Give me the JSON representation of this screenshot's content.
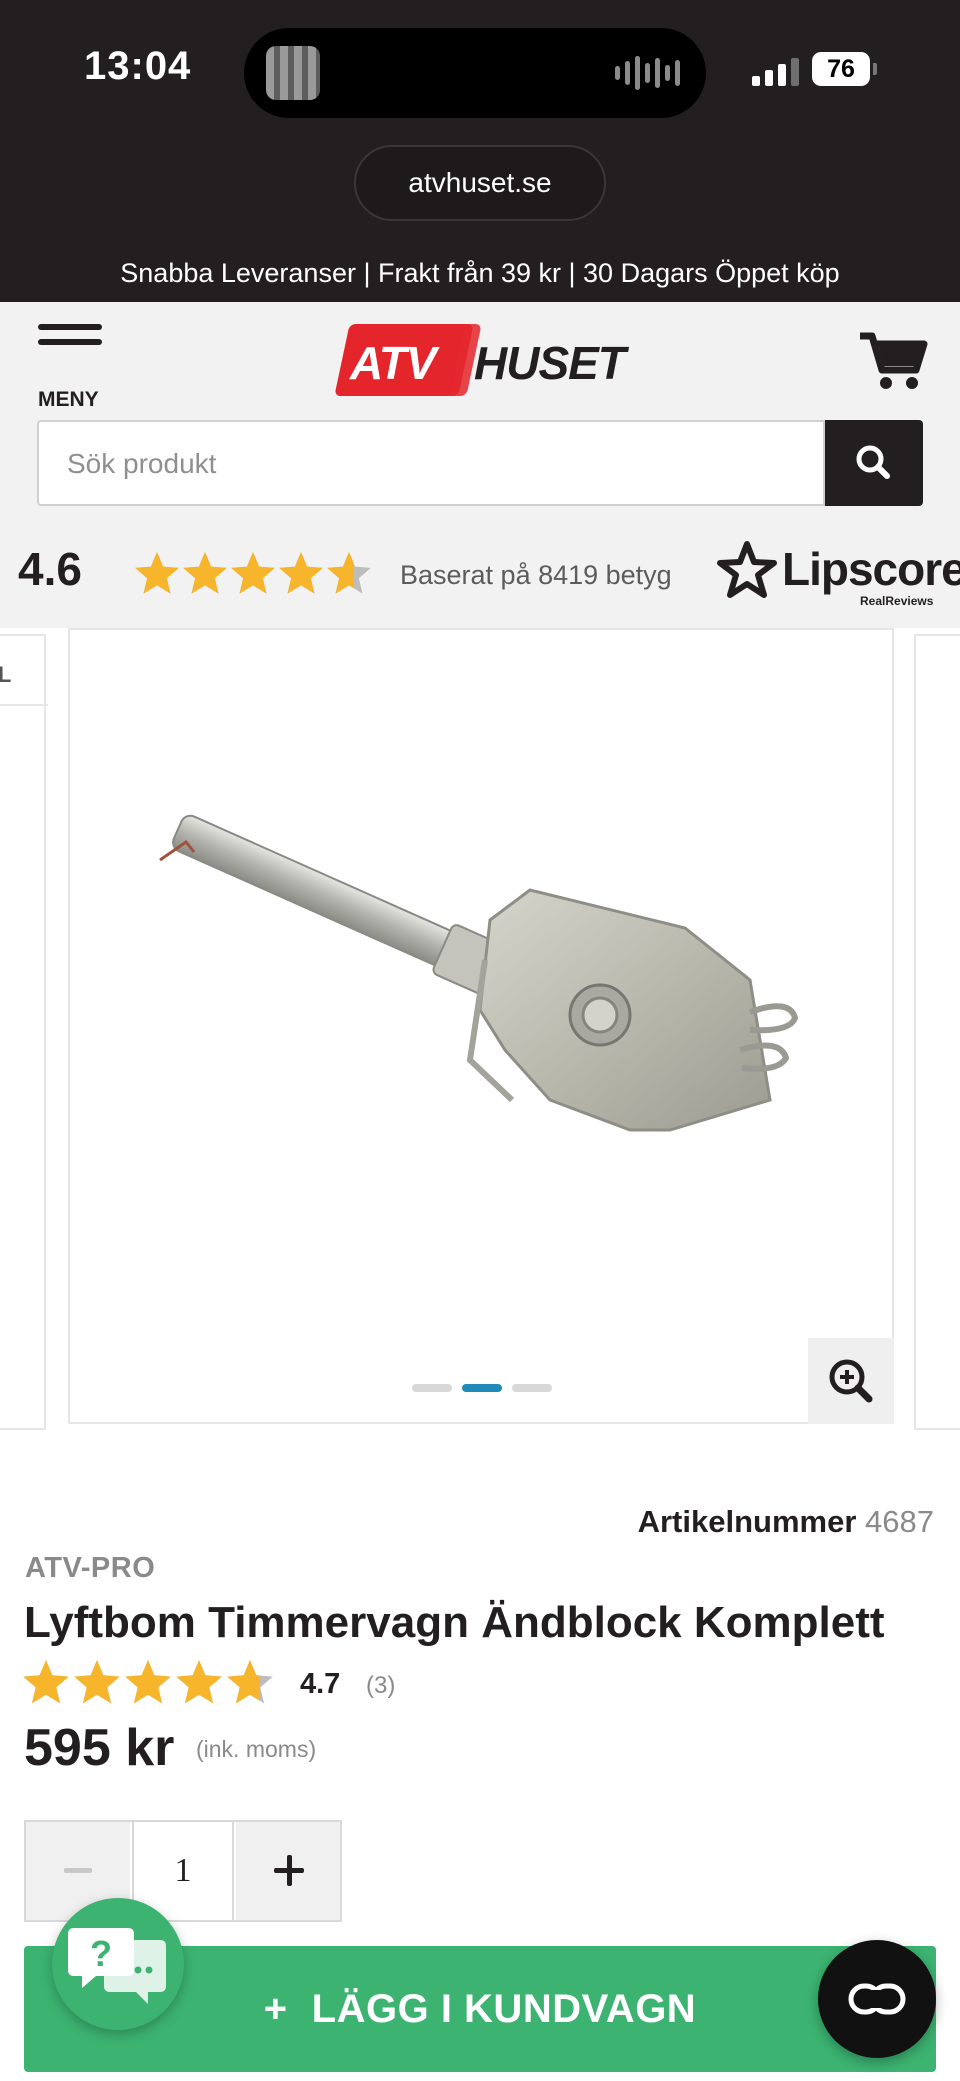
{
  "status_bar": {
    "time": "13:04",
    "battery": "76"
  },
  "browser": {
    "url": "atvhuset.se"
  },
  "promo_text": "Snabba Leveranser | Frakt från 39 kr | 30 Dagars Öppet köp",
  "header": {
    "menu_label": "MENY",
    "logo_left": "ATV",
    "logo_right": "HUSET",
    "search_placeholder": "Sök produkt"
  },
  "store_rating": {
    "score": "4.6",
    "stars": 4.6,
    "based_on": "Baserat på 8419 betyg",
    "provider": "Lipscore",
    "provider_sub": "RealReviews"
  },
  "gallery": {
    "left_card_label": "AL",
    "slide_count": 3,
    "active_slide": 2
  },
  "product": {
    "article_label": "Artikelnummer",
    "article_number": "4687",
    "brand": "ATV-PRO",
    "title": "Lyftbom Timmervagn Ändblock Komplett",
    "rating": "4.7",
    "rating_stars": 4.7,
    "review_count": "(3)",
    "price": "595 kr",
    "vat_note": "(ink. moms)",
    "quantity": "1",
    "add_to_cart_icon": "+",
    "add_to_cart": "LÄGG I KUNDVAGN"
  },
  "colors": {
    "brand_red": "#e4262c",
    "dark": "#231f20",
    "star": "#f7b52c",
    "cta_green": "#3cb371",
    "dot_active": "#1f8ab8"
  },
  "icons": {
    "menu": "hamburger-icon",
    "cart": "cart-icon",
    "search": "search-icon",
    "zoom": "zoom-in-icon",
    "help": "help-chat-icon",
    "chat": "chat-icon"
  }
}
